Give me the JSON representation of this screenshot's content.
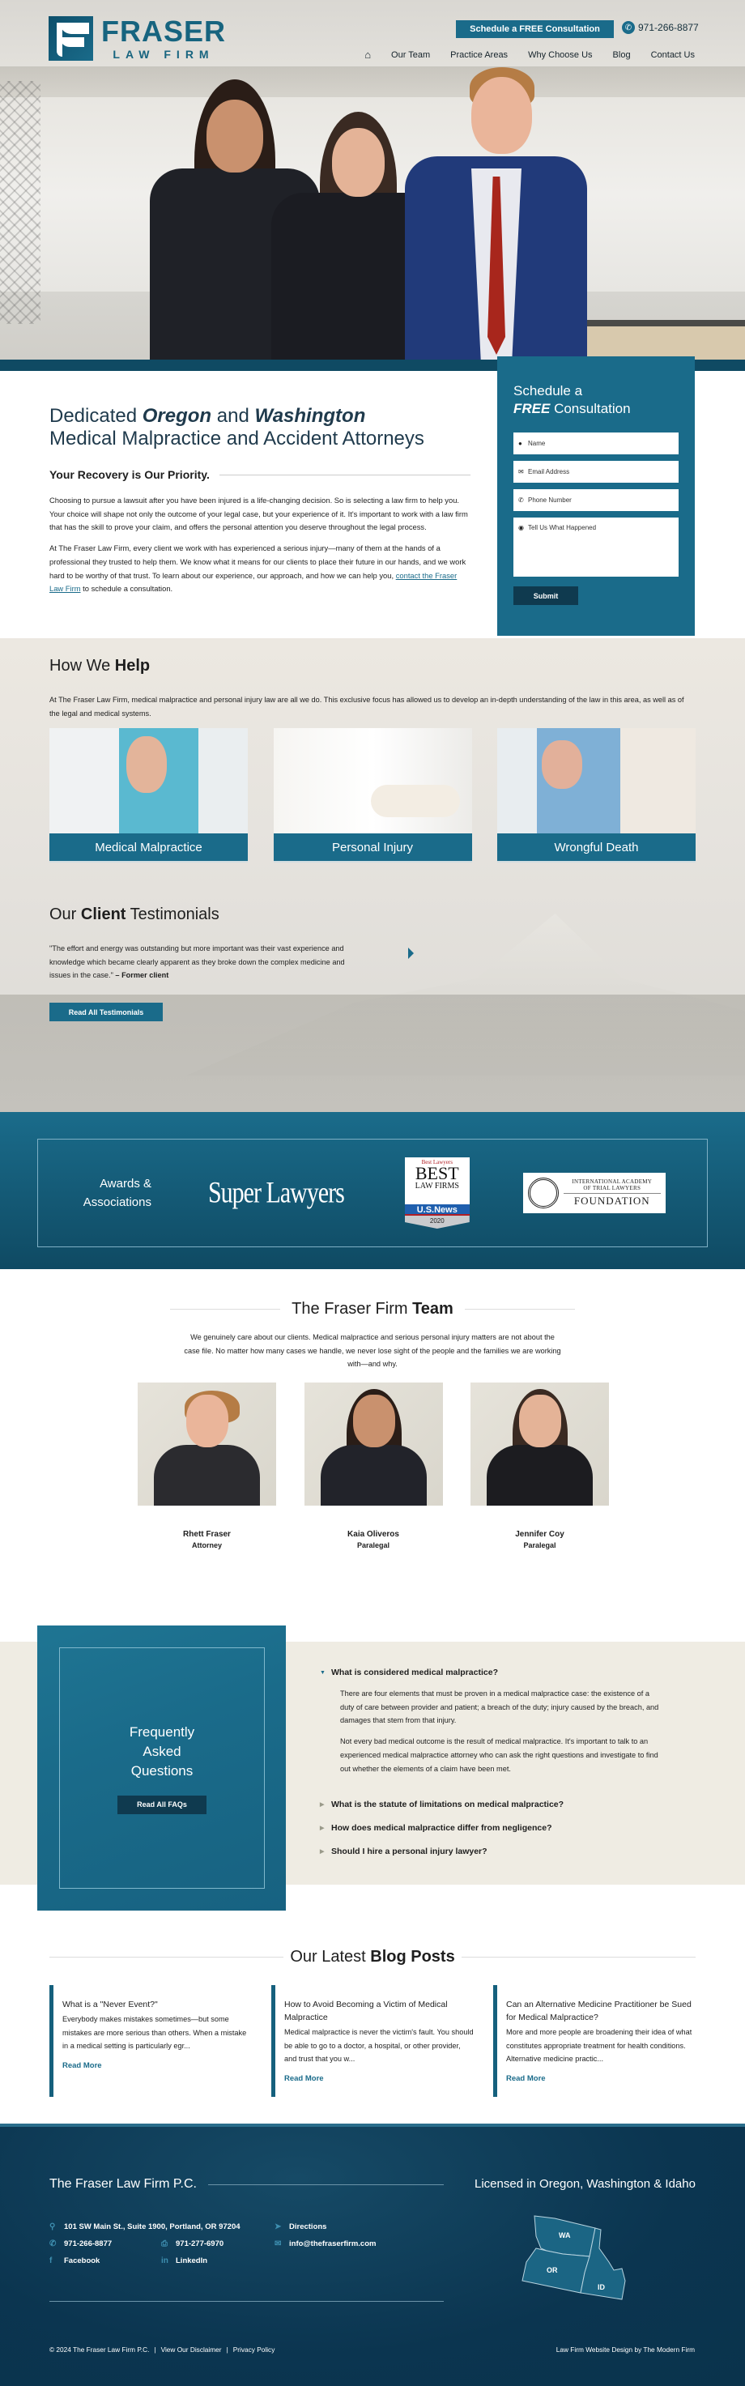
{
  "header": {
    "logo_title": "FRASER",
    "logo_subtitle": "LAW FIRM",
    "cta_label": "Schedule a FREE Consultation",
    "phone": "971-266-8877",
    "nav": [
      "Our Team",
      "Practice Areas",
      "Why Choose Us",
      "Blog",
      "Contact Us"
    ]
  },
  "intro": {
    "heading_pre": "Dedicated ",
    "heading_state1": "Oregon",
    "heading_mid": " and ",
    "heading_state2": "Washington",
    "heading_line2": "Medical Malpractice and Accident Attorneys",
    "subheading": "Your Recovery is Our Priority.",
    "para1": "Choosing to pursue a lawsuit after you have been injured is a life-changing decision. So is selecting a law firm to help you. Your choice will shape not only the outcome of your legal case, but your experience of it. It's important to work with a law firm that has the skill to prove your claim, and offers the personal attention you deserve throughout the legal process.",
    "para2": "At The Fraser Law Firm, every client we work with has experienced a serious injury—many of them at the hands of a professional they trusted to help them. We know what it means for our clients to place their future in our hands, and we work hard to be worthy of that trust. To learn about our experience, our approach, and how we can help you, ",
    "para2_link": "contact the Fraser Law Firm",
    "para2_end": " to schedule a consultation."
  },
  "form": {
    "title_line1": "Schedule a",
    "title_free": "FREE",
    "title_rest": " Consultation",
    "fields": [
      {
        "icon": "person-icon",
        "placeholder": "Name"
      },
      {
        "icon": "envelope-icon",
        "placeholder": "Email Address"
      },
      {
        "icon": "phone-icon",
        "placeholder": "Phone Number"
      },
      {
        "icon": "chat-icon",
        "placeholder": "Tell Us What Happened"
      }
    ],
    "submit_label": "Submit"
  },
  "help": {
    "title_pre": "How We ",
    "title_bold": "Help",
    "description": "At The Fraser Law Firm, medical malpractice and personal injury law are all we do. This exclusive focus has allowed us to develop an in-depth understanding of the law in this area, as well as of the legal and medical systems.",
    "cards": [
      "Medical Malpractice",
      "Personal Injury",
      "Wrongful Death"
    ]
  },
  "testimonials": {
    "title_pre": "Our ",
    "title_bold": "Client",
    "title_post": " Testimonials",
    "quote": "\"The effort and energy was outstanding but more important was their vast experience and knowledge which became clearly apparent as they broke down the complex medicine and issues in the case.\" ",
    "author": "– Former client",
    "button_label": "Read All Testimonials"
  },
  "awards": {
    "title_line1": "Awards &",
    "title_line2": "Associations",
    "super_lawyers": "Super Lawyers",
    "badge_brand": "Best Lawyers",
    "badge_best": "BEST",
    "badge_firms": "LAW FIRMS",
    "badge_usnews": "U.S.News",
    "badge_year": "2020",
    "iatl_line1": "INTERNATIONAL ACADEMY",
    "iatl_line2": "OF TRIAL LAWYERS",
    "iatl_line3": "FOUNDATION"
  },
  "team": {
    "title_pre": "The Fraser Firm ",
    "title_bold": "Team",
    "description": "We genuinely care about our clients. Medical malpractice and serious personal injury matters are not about the case file. No matter how many cases we handle, we never lose sight of the people and the families we are working with—and why.",
    "members": [
      {
        "name": "Rhett Fraser",
        "role": "Attorney"
      },
      {
        "name": "Kaia Oliveros",
        "role": "Paralegal"
      },
      {
        "name": "Jennifer Coy",
        "role": "Paralegal"
      }
    ]
  },
  "faq": {
    "title": "Frequently Asked Questions",
    "button_label": "Read All FAQs",
    "open_question": "What is considered medical malpractice?",
    "open_answer_p1": "There are four elements that must be proven in a medical malpractice case: the existence of a duty of care between provider and patient; a breach of the duty; injury caused by the breach, and damages that stem from that injury.",
    "open_answer_p2": "Not every bad medical outcome is the result of medical malpractice. It's important to talk to an experienced medical malpractice attorney who can ask the right questions and investigate to find out whether the elements of a claim have been met.",
    "closed_questions": [
      "What is the statute of limitations on medical malpractice?",
      "How does medical malpractice differ from negligence?",
      "Should I hire a personal injury lawyer?"
    ]
  },
  "blog": {
    "title_pre": "Our Latest ",
    "title_bold": "Blog Posts",
    "read_more": "Read More",
    "posts": [
      {
        "title": "What is a \"Never Event?\"",
        "excerpt": "Everybody makes mistakes sometimes—but some mistakes are more serious than others. When a mistake in a medical setting is particularly egr..."
      },
      {
        "title": "How to Avoid Becoming a Victim of Medical Malpractice",
        "excerpt": "Medical malpractice is never the victim's fault. You should be able to go to a doctor, a hospital, or other provider, and trust that you w..."
      },
      {
        "title": "Can an Alternative Medicine Practitioner be Sued for Medical Malpractice?",
        "excerpt": "More and more people are broadening their idea of what constitutes appropriate treatment for health conditions. Alternative medicine practic..."
      }
    ]
  },
  "footer": {
    "firm_name": "The Fraser Law Firm P.C.",
    "licensed": "Licensed in Oregon, Washington & Idaho",
    "address": "101 SW Main St., Suite 1900, Portland, OR 97204",
    "directions": "Directions",
    "phone": "971-266-8877",
    "fax": "971-277-6970",
    "email": "info@thefraserfirm.com",
    "facebook": "Facebook",
    "linkedin": "LinkedIn",
    "states": [
      "WA",
      "OR",
      "ID"
    ],
    "copyright": "© 2024 The Fraser Law Firm P.C.",
    "disclaimer": "View Our Disclaimer",
    "privacy": "Privacy Policy",
    "credit": "Law Firm Website Design by The Modern Firm",
    "separator": "|"
  },
  "colors": {
    "brand_teal": "#1a6b8a",
    "dark_navy": "#0f3a4f",
    "footer_navy": "#0b3550"
  }
}
